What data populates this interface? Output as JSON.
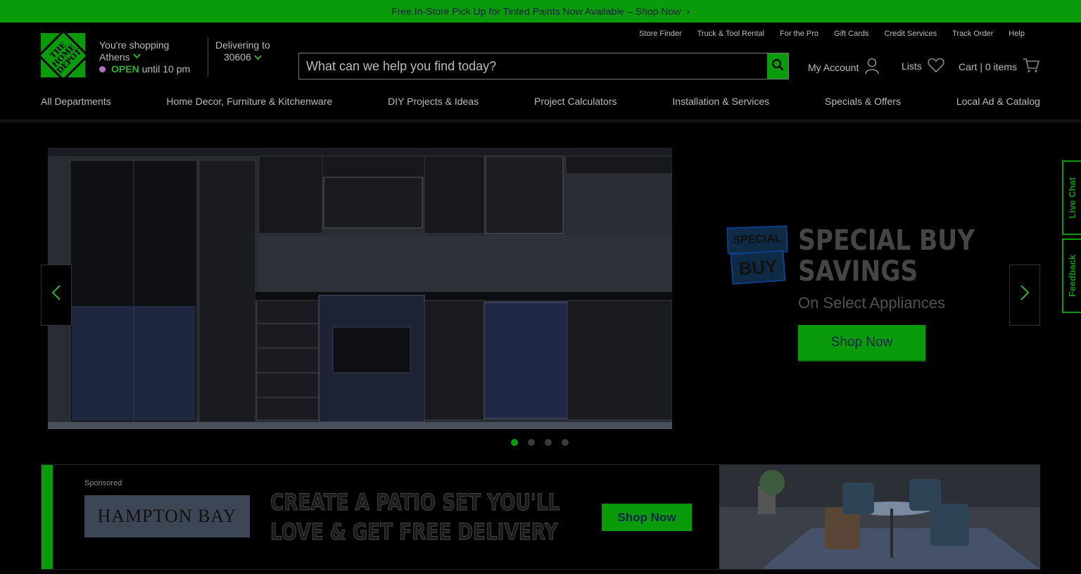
{
  "promo": {
    "text": "Free In-Store Pick Up for Tinted Paints Now Available – Shop Now",
    "chevron": "›"
  },
  "logo": {
    "line1": "THE",
    "line2": "HOME",
    "line3": "DEPOT"
  },
  "store": {
    "shopping": "You're shopping",
    "name": "Athens",
    "open": "OPEN",
    "hours": "until 10 pm"
  },
  "delivery": {
    "label": "Delivering to",
    "zip": "30606"
  },
  "utility_links": [
    "Store Finder",
    "Truck & Tool Rental",
    "For the Pro",
    "Gift Cards",
    "Credit Services",
    "Track Order",
    "Help"
  ],
  "search": {
    "placeholder": "What can we help you find today?"
  },
  "account": {
    "my_account": "My Account",
    "lists": "Lists",
    "cart": "Cart | 0 items"
  },
  "nav": [
    "All Departments",
    "Home Decor, Furniture & Kitchenware",
    "DIY Projects & Ideas",
    "Project Calculators",
    "Installation & Services",
    "Specials & Offers",
    "Local Ad & Catalog"
  ],
  "hero": {
    "badge_top": "SPECIAL",
    "badge_bottom": "BUY",
    "title_line1": "SPECIAL BUY",
    "title_line2": "SAVINGS",
    "subtitle": "On Select Appliances",
    "cta": "Shop Now",
    "slides": 4,
    "active_slide": 1
  },
  "side_tabs": {
    "live_chat": "Live Chat",
    "feedback": "Feedback"
  },
  "sponsored_ad": {
    "sponsored_label": "Sponsored",
    "brand": "HAMPTON BAY",
    "headline_line1": "CREATE A PATIO SET YOU'LL",
    "headline_line2": "LOVE & GET FREE DELIVERY",
    "cta": "Shop Now"
  },
  "colors": {
    "brand_green": "#0a9b0a",
    "background": "#000000"
  }
}
